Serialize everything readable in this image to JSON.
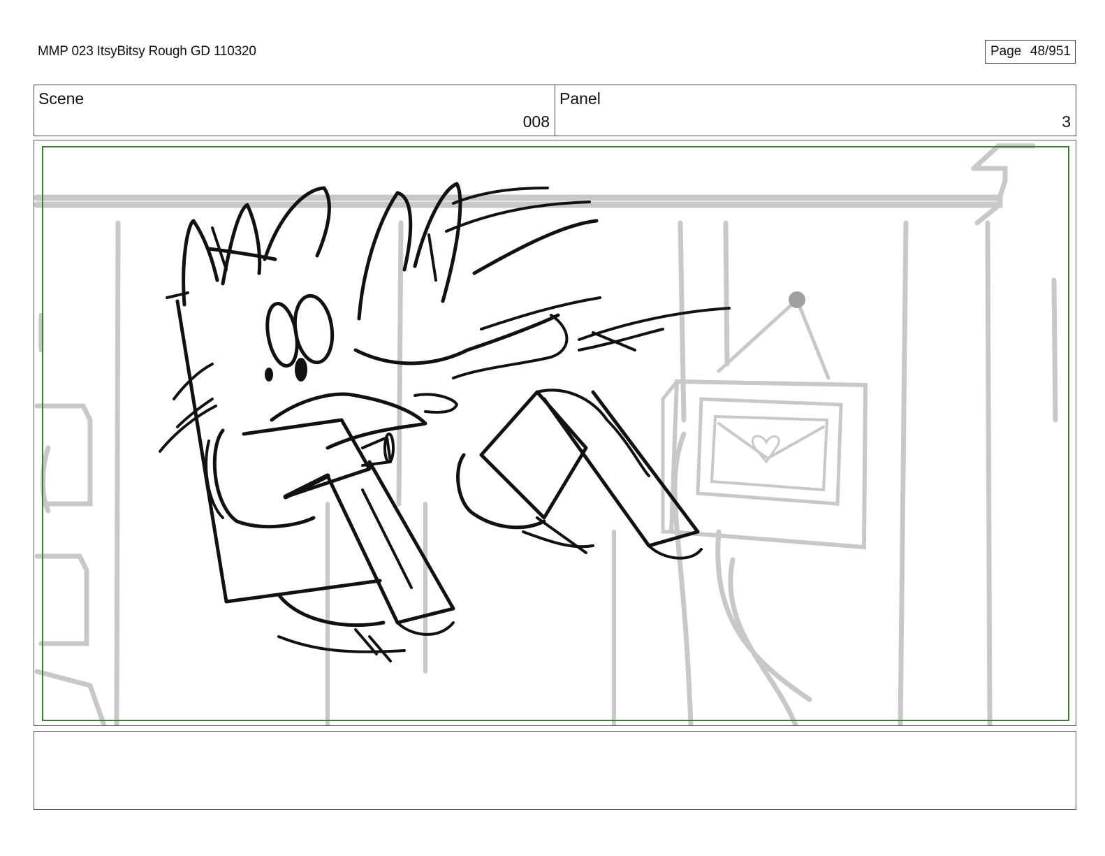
{
  "header": {
    "document_title": "MMP 023 ItsyBitsy Rough GD 110320",
    "page_label": "Page",
    "page_number": "48/951"
  },
  "meta": {
    "scene_label": "Scene",
    "scene_value": "008",
    "panel_label": "Panel",
    "panel_value": "3"
  },
  "notes": {
    "text": ""
  },
  "colors": {
    "safe_area_border": "#3a7d2c",
    "sketch_ink": "#111111",
    "background_sketch": "#c8c8c8"
  }
}
